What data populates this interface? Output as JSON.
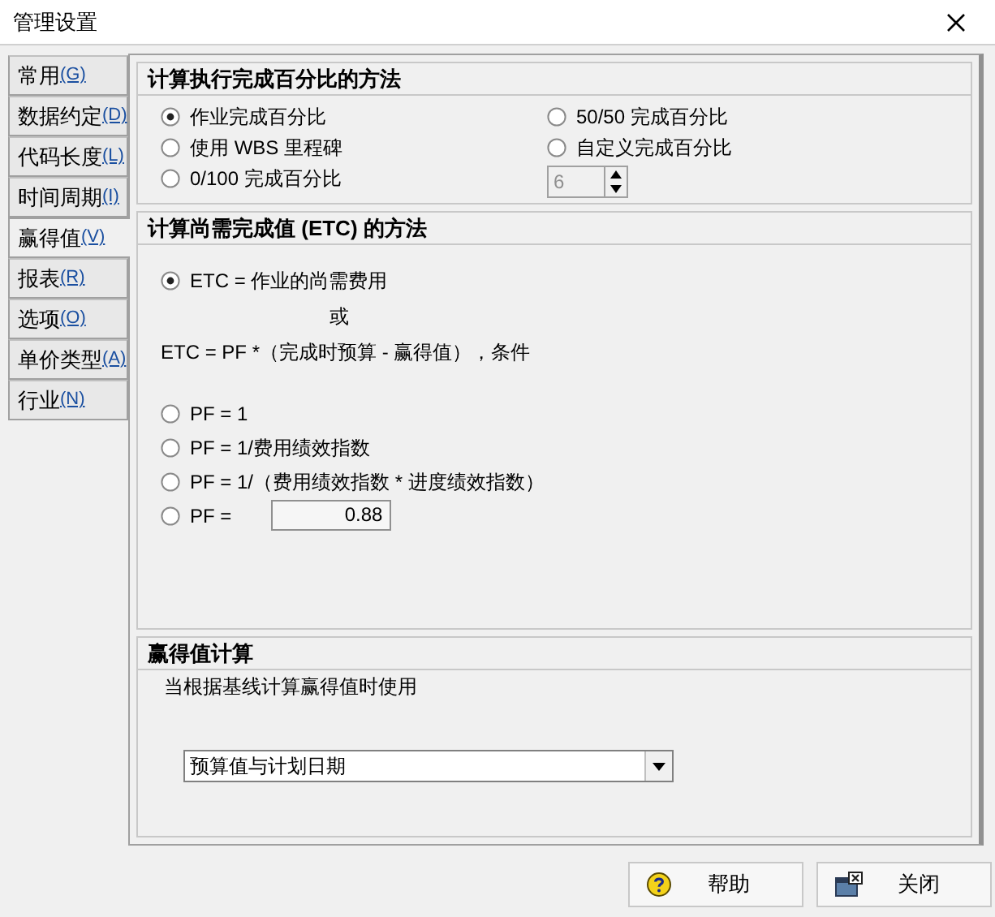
{
  "window": {
    "title": "管理设置"
  },
  "tabs": [
    {
      "label": "常用",
      "hotkey": "(G)",
      "selected": false
    },
    {
      "label": "数据约定",
      "hotkey": "(D)",
      "selected": false
    },
    {
      "label": "代码长度",
      "hotkey": "(L)",
      "selected": false
    },
    {
      "label": "时间周期",
      "hotkey": "(I)",
      "selected": false
    },
    {
      "label": "赢得值",
      "hotkey": "(V)",
      "selected": true
    },
    {
      "label": "报表",
      "hotkey": "(R)",
      "selected": false
    },
    {
      "label": "选项",
      "hotkey": "(O)",
      "selected": false
    },
    {
      "label": "单价类型",
      "hotkey": "(A)",
      "selected": false
    },
    {
      "label": "行业",
      "hotkey": "(N)",
      "selected": false
    }
  ],
  "percent_complete_method": {
    "title": "计算执行完成百分比的方法",
    "left_options": [
      {
        "label": "作业完成百分比",
        "selected": true
      },
      {
        "label": "使用 WBS 里程碑",
        "selected": false
      },
      {
        "label": "0/100 完成百分比",
        "selected": false
      }
    ],
    "right_options": [
      {
        "label": "50/50 完成百分比",
        "selected": false
      },
      {
        "label": "自定义完成百分比",
        "selected": false
      }
    ],
    "spinner": {
      "value": "6",
      "disabled": true
    }
  },
  "etc_method": {
    "title": "计算尚需完成值 (ETC) 的方法",
    "primary_option": {
      "label": "ETC = 作业的尚需费用",
      "selected": true
    },
    "or_text": "或",
    "formula_text": "ETC = PF *（完成时预算 - 赢得值），条件",
    "pf_options": [
      {
        "label": "PF = 1",
        "selected": false
      },
      {
        "label": "PF = 1/费用绩效指数",
        "selected": false
      },
      {
        "label": "PF = 1/（费用绩效指数 * 进度绩效指数）",
        "selected": false
      },
      {
        "label": "PF =",
        "selected": false,
        "value": "0.88"
      }
    ]
  },
  "earned_value": {
    "title": "赢得值计算",
    "description": "当根据基线计算赢得值时使用",
    "dropdown": {
      "value": "预算值与计划日期"
    }
  },
  "buttons": [
    {
      "kind": "help",
      "label": "帮助"
    },
    {
      "kind": "close",
      "label": "关闭"
    }
  ]
}
